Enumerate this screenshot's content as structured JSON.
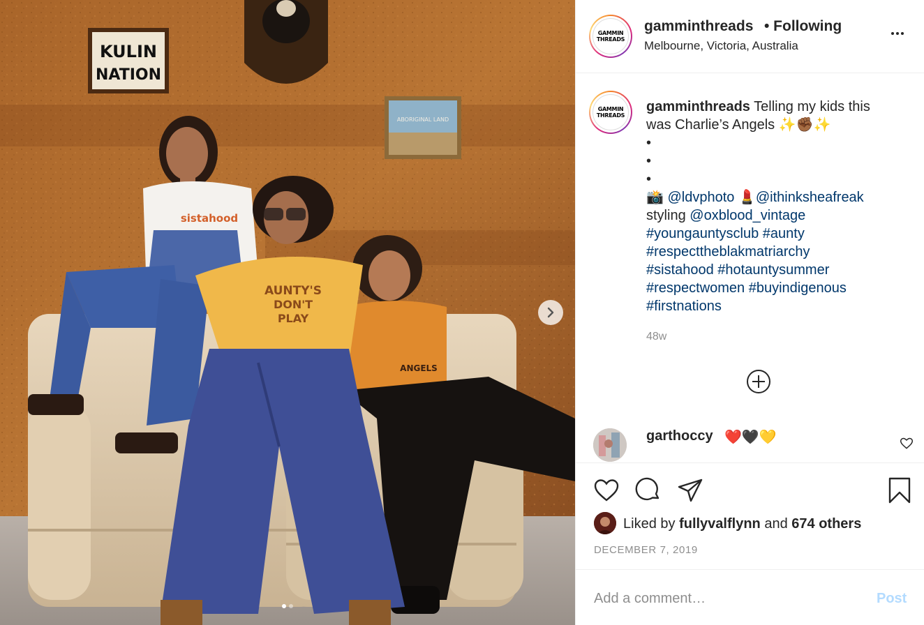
{
  "post": {
    "username": "gamminthreads",
    "follow_status": "• Following",
    "location": "Melbourne, Victoria, Australia",
    "avatar_logo_lines": [
      "GAMMIN",
      "THREADS"
    ],
    "photo_signs": {
      "wall_sign_line1": "KULIN",
      "wall_sign_line2": "NATION",
      "painting_text": "ABORIGINAL LAND",
      "shirt_left": "sistahood",
      "shirt_middle_line1": "AUNTY'S",
      "shirt_middle_line2": "DON'T",
      "shirt_middle_line3": "PLAY",
      "shirt_right": "ANGELS"
    }
  },
  "caption": {
    "username": "gamminthreads",
    "text_line1": "Telling my kids this",
    "text_line2": "was Charlie’s Angels ✨✊🏾✨",
    "bullets": [
      "•",
      "•",
      "•"
    ],
    "camera_emoji": "📸",
    "mention1": "@ldvphoto",
    "lipstick_emoji": "💄",
    "mention2": "@ithinksheafreak",
    "styling_prefix": "styling",
    "mention3": "@oxblood_vintage",
    "hashtag_lines": [
      "#youngauntysclub #aunty",
      "#respecttheblakmatriarchy",
      "#sistahood #hotauntysummer",
      "#respectwomen #buyindigenous",
      "#firstnations"
    ],
    "time_ago": "48w"
  },
  "comment": {
    "username": "garthoccy",
    "text": "❤️🖤💛"
  },
  "likes": {
    "prefix": "Liked by",
    "user": "fullyvalflynn",
    "middle": "and",
    "others": "674 others"
  },
  "date": "DECEMBER 7, 2019",
  "comment_box": {
    "placeholder": "Add a comment…",
    "post_label": "Post"
  },
  "carousel": {
    "slide_count": 2,
    "active_index": 0
  },
  "icons": [
    "more-options-icon",
    "chevron-right-icon",
    "add-circle-icon",
    "heart-icon",
    "comment-icon",
    "share-icon",
    "bookmark-icon"
  ],
  "colors": {
    "link": "#00376b",
    "muted": "#8e8e8e",
    "post_button_disabled": "#b3dbff",
    "text": "#262626"
  }
}
